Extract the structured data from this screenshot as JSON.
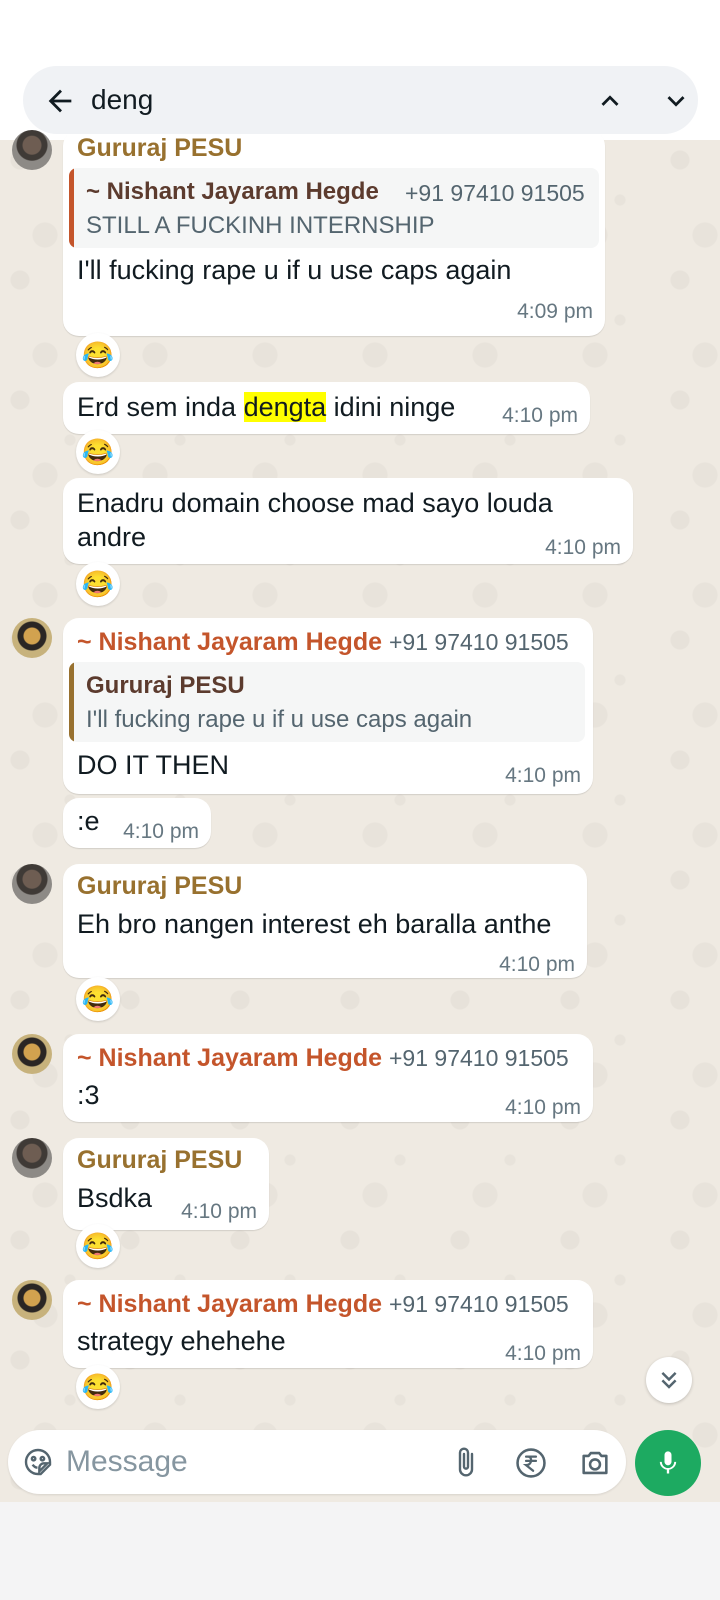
{
  "search": {
    "query": "deng"
  },
  "messages": [
    {
      "sender": "Gururaj PESU",
      "quote": {
        "name": "~ Nishant Jayaram Hegde",
        "phone": "+91 97410 91505",
        "text": "STILL A FUCKINH INTERNSHIP"
      },
      "text": "I'll fucking rape u if u use caps again",
      "time": "4:09 pm",
      "reaction": "😂"
    },
    {
      "text_before": "Erd sem inda ",
      "text_highlight": "dengta",
      "text_after": " idini ninge",
      "time": "4:10 pm",
      "reaction": "😂"
    },
    {
      "text": "Enadru domain choose mad sayo louda andre",
      "time": "4:10 pm",
      "reaction": "😂"
    },
    {
      "sender": "~ Nishant Jayaram Hegde",
      "phone": "+91 97410 91505",
      "quote": {
        "name": "Gururaj PESU",
        "text": "I'll fucking rape u if u use caps again"
      },
      "text": "DO IT THEN",
      "time": "4:10 pm"
    },
    {
      "text": ":e",
      "time": "4:10 pm"
    },
    {
      "sender": "Gururaj PESU",
      "text": "Eh bro nangen interest eh baralla anthe",
      "time": "4:10 pm",
      "reaction": "😂"
    },
    {
      "sender": "~ Nishant Jayaram Hegde",
      "phone": "+91 97410 91505",
      "text": ":3",
      "time": "4:10 pm"
    },
    {
      "sender": "Gururaj PESU",
      "text": "Bsdka",
      "time": "4:10 pm",
      "reaction": "😂"
    },
    {
      "sender": "~ Nishant Jayaram Hegde",
      "phone": "+91 97410 91505",
      "text": "strategy ehehehe",
      "time": "4:10 pm",
      "reaction": "😂"
    }
  ],
  "composer": {
    "placeholder": "Message"
  },
  "colors": {
    "gururaj_name": "#98712f",
    "nishant_name": "#c4552b",
    "send_button": "#1daa61",
    "highlight": "#ffff00"
  },
  "icons": [
    "back-arrow-icon",
    "chevron-up-icon",
    "chevron-down-icon",
    "emoji-sticker-icon",
    "attach-icon",
    "rupee-payment-icon",
    "camera-icon",
    "microphone-icon",
    "double-chevron-down-icon"
  ]
}
